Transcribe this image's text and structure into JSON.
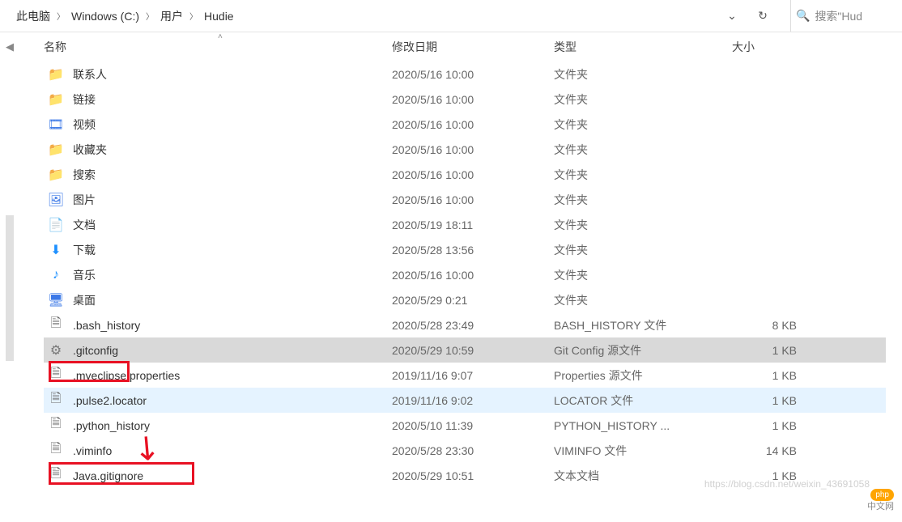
{
  "breadcrumb": [
    "此电脑",
    "Windows (C:)",
    "用户",
    "Hudie"
  ],
  "search_placeholder": "搜索\"Hud",
  "columns": {
    "name": "名称",
    "date": "修改日期",
    "type": "类型",
    "size": "大小"
  },
  "rows": [
    {
      "icon": "folder",
      "name": "联系人",
      "date": "2020/5/16 10:00",
      "type": "文件夹",
      "size": ""
    },
    {
      "icon": "folder",
      "name": "链接",
      "date": "2020/5/16 10:00",
      "type": "文件夹",
      "size": ""
    },
    {
      "icon": "video",
      "name": "视频",
      "date": "2020/5/16 10:00",
      "type": "文件夹",
      "size": ""
    },
    {
      "icon": "folder",
      "name": "收藏夹",
      "date": "2020/5/16 10:00",
      "type": "文件夹",
      "size": ""
    },
    {
      "icon": "folder",
      "name": "搜索",
      "date": "2020/5/16 10:00",
      "type": "文件夹",
      "size": ""
    },
    {
      "icon": "picture",
      "name": "图片",
      "date": "2020/5/16 10:00",
      "type": "文件夹",
      "size": ""
    },
    {
      "icon": "doc",
      "name": "文档",
      "date": "2020/5/19 18:11",
      "type": "文件夹",
      "size": ""
    },
    {
      "icon": "download",
      "name": "下载",
      "date": "2020/5/28 13:56",
      "type": "文件夹",
      "size": ""
    },
    {
      "icon": "music",
      "name": "音乐",
      "date": "2020/5/16 10:00",
      "type": "文件夹",
      "size": ""
    },
    {
      "icon": "desktop",
      "name": "桌面",
      "date": "2020/5/29 0:21",
      "type": "文件夹",
      "size": ""
    },
    {
      "icon": "file",
      "name": ".bash_history",
      "date": "2020/5/28 23:49",
      "type": "BASH_HISTORY 文件",
      "size": "8 KB"
    },
    {
      "icon": "cfg",
      "name": ".gitconfig",
      "date": "2020/5/29 10:59",
      "type": "Git Config 源文件",
      "size": "1 KB",
      "state": "selected"
    },
    {
      "icon": "file",
      "name": ".myeclipse.properties",
      "date": "2019/11/16 9:07",
      "type": "Properties 源文件",
      "size": "1 KB"
    },
    {
      "icon": "file",
      "name": ".pulse2.locator",
      "date": "2019/11/16 9:02",
      "type": "LOCATOR 文件",
      "size": "1 KB",
      "state": "hover"
    },
    {
      "icon": "file",
      "name": ".python_history",
      "date": "2020/5/10 11:39",
      "type": "PYTHON_HISTORY ...",
      "size": "1 KB"
    },
    {
      "icon": "file",
      "name": ".viminfo",
      "date": "2020/5/28 23:30",
      "type": "VIMINFO 文件",
      "size": "14 KB"
    },
    {
      "icon": "file",
      "name": "Java.gitignore",
      "date": "2020/5/29 10:51",
      "type": "文本文档",
      "size": "1 KB"
    }
  ],
  "watermark": "https://blog.csdn.net/weixin_43691058",
  "php_label": "php",
  "php_cn": "中文网"
}
